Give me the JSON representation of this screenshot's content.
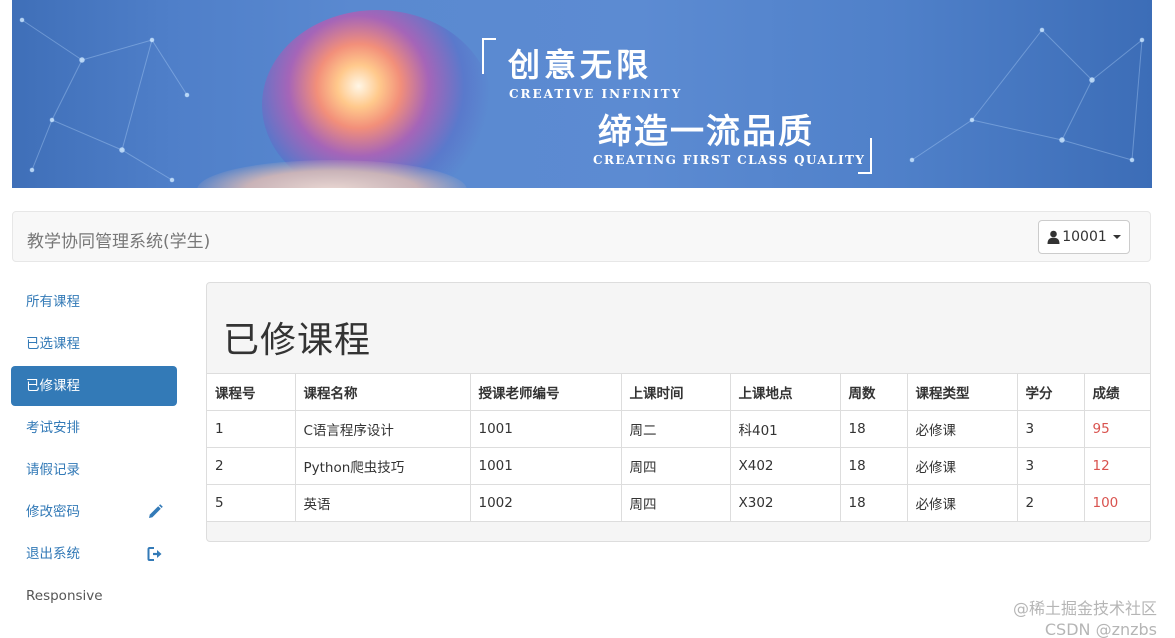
{
  "banner": {
    "slogan1": "创意无限",
    "slogan1_en": "CREATIVE INFINITY",
    "slogan2": "缔造一流品质",
    "slogan2_en": "CREATING FIRST CLASS QUALITY"
  },
  "navbar": {
    "brand": "教学协同管理系统(学生)",
    "user_id": "10001",
    "user_icon": "user-icon"
  },
  "sidebar": {
    "items": [
      {
        "label": "所有课程"
      },
      {
        "label": "已选课程"
      },
      {
        "label": "已修课程",
        "active": true
      },
      {
        "label": "考试安排"
      },
      {
        "label": "请假记录"
      },
      {
        "label": "修改密码",
        "icon": "pencil-icon"
      },
      {
        "label": "退出系统",
        "icon": "logout-icon"
      },
      {
        "label": "Responsive"
      }
    ]
  },
  "main": {
    "title": "已修课程",
    "table": {
      "headers": [
        "课程号",
        "课程名称",
        "授课老师编号",
        "上课时间",
        "上课地点",
        "周数",
        "课程类型",
        "学分",
        "成绩"
      ],
      "rows": [
        [
          "1",
          "C语言程序设计",
          "1001",
          "周二",
          "科401",
          "18",
          "必修课",
          "3",
          "95"
        ],
        [
          "2",
          "Python爬虫技巧",
          "1001",
          "周四",
          "X402",
          "18",
          "必修课",
          "3",
          "12"
        ],
        [
          "5",
          "英语",
          "1002",
          "周四",
          "X302",
          "18",
          "必修课",
          "2",
          "100"
        ]
      ]
    }
  },
  "colors": {
    "primary": "#337ab7",
    "score": "#d9534f"
  },
  "watermark": {
    "line1": "@稀土掘金技术社区",
    "line2": "CSDN @znzbs"
  }
}
